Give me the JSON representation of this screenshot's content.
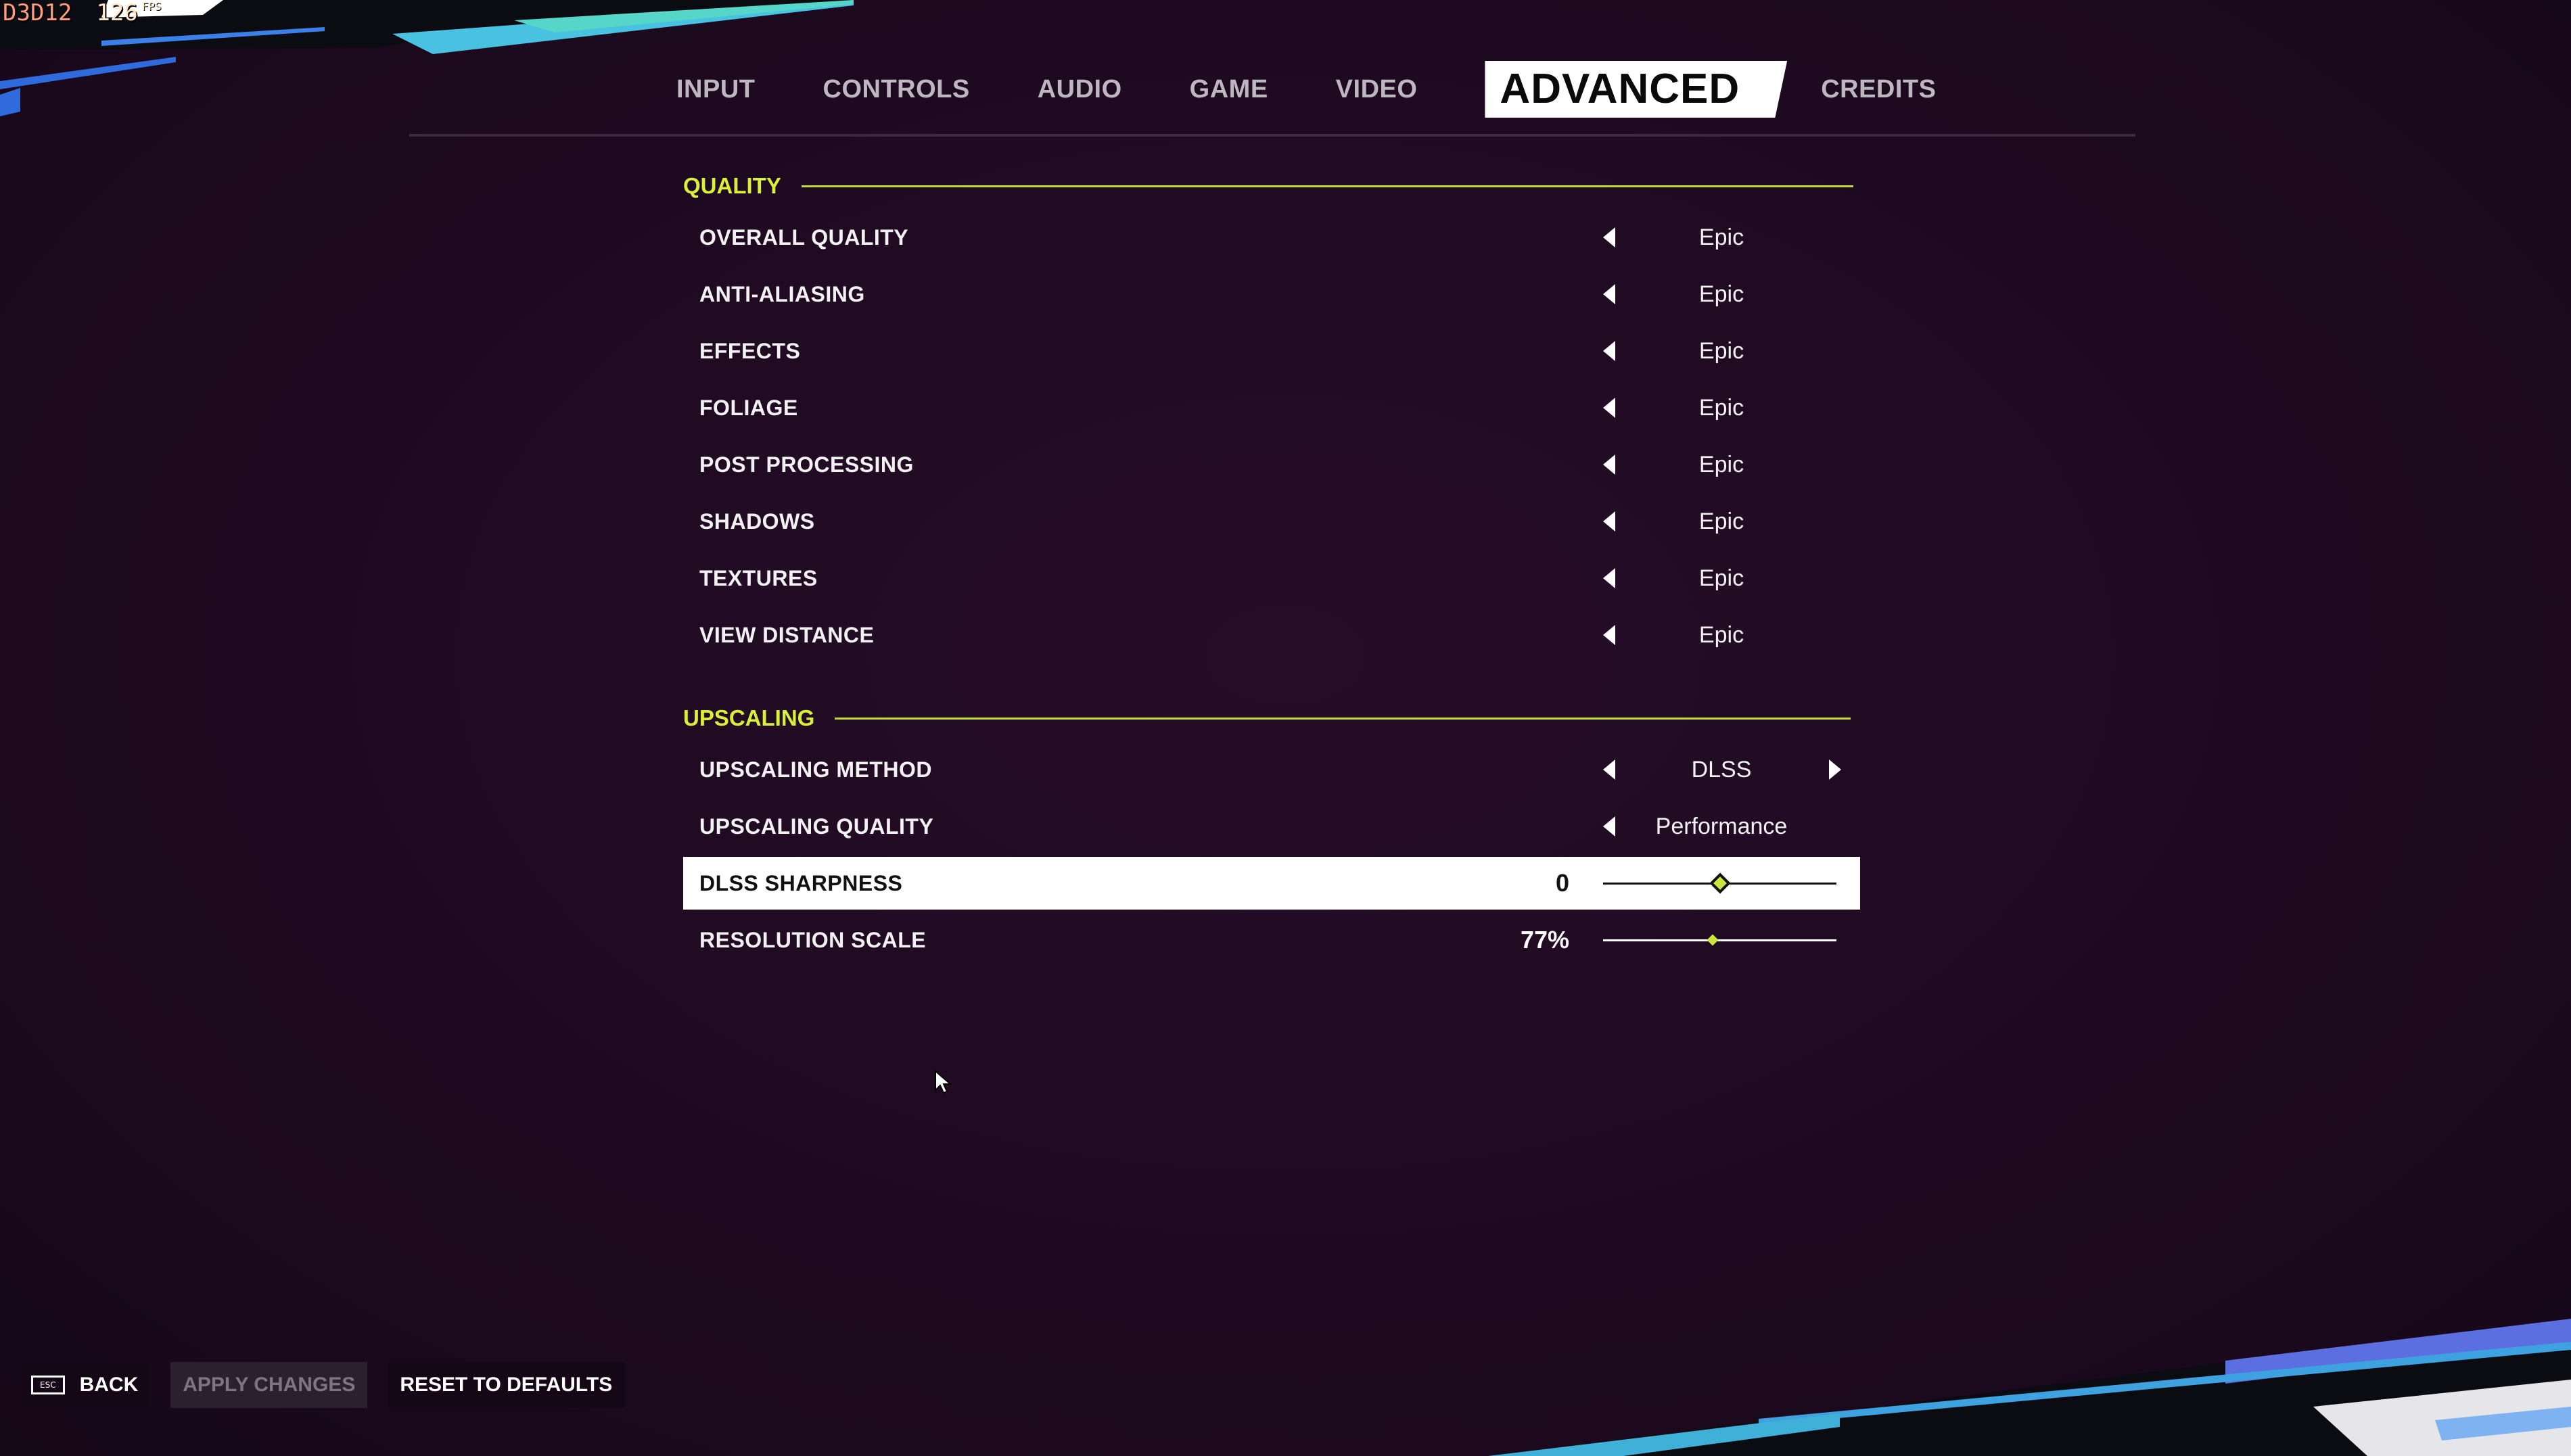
{
  "overlay": {
    "api": "D3D12",
    "fps": "126",
    "fps_unit": "FPS"
  },
  "tabs": [
    {
      "label": "INPUT",
      "active": false
    },
    {
      "label": "CONTROLS",
      "active": false
    },
    {
      "label": "AUDIO",
      "active": false
    },
    {
      "label": "GAME",
      "active": false
    },
    {
      "label": "VIDEO",
      "active": false
    },
    {
      "label": "ADVANCED",
      "active": true
    },
    {
      "label": "CREDITS",
      "active": false
    }
  ],
  "quality": {
    "title": "QUALITY",
    "rows": [
      {
        "label": "OVERALL QUALITY",
        "value": "Epic"
      },
      {
        "label": "ANTI-ALIASING",
        "value": "Epic"
      },
      {
        "label": "EFFECTS",
        "value": "Epic"
      },
      {
        "label": "FOLIAGE",
        "value": "Epic"
      },
      {
        "label": "POST PROCESSING",
        "value": "Epic"
      },
      {
        "label": "SHADOWS",
        "value": "Epic"
      },
      {
        "label": "TEXTURES",
        "value": "Epic"
      },
      {
        "label": "VIEW DISTANCE",
        "value": "Epic"
      }
    ]
  },
  "upscaling": {
    "title": "UPSCALING",
    "method": {
      "label": "UPSCALING METHOD",
      "value": "DLSS"
    },
    "quality": {
      "label": "UPSCALING QUALITY",
      "value": "Performance"
    },
    "sharpness": {
      "label": "DLSS SHARPNESS",
      "value": "0",
      "level": 0.5
    },
    "resolution": {
      "label": "RESOLUTION SCALE",
      "value": "77%",
      "level": 0.47
    }
  },
  "bottom": {
    "back_key": "ESC",
    "back_label": "BACK",
    "apply_label": "APPLY CHANGES",
    "reset_label": "RESET TO DEFAULTS"
  },
  "colors": {
    "accent": "#d9f03a",
    "background": "#1c0a1e",
    "highlight": "#ffffff"
  }
}
